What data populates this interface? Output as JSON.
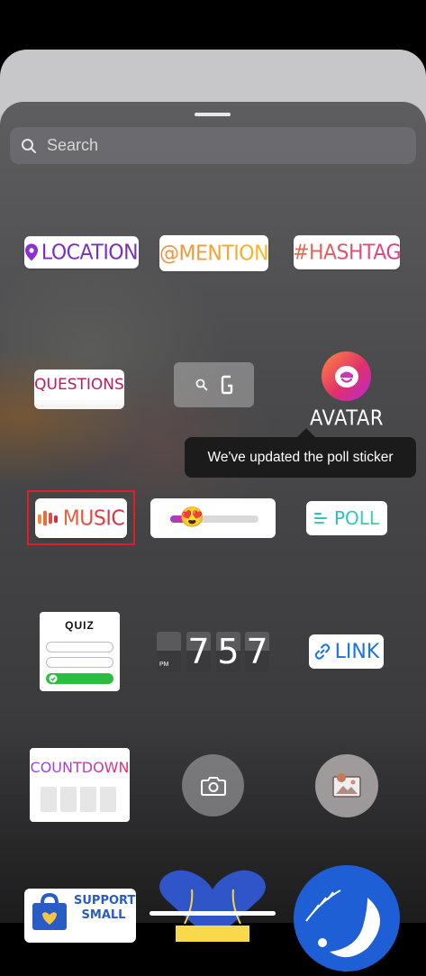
{
  "search": {
    "placeholder": "Search"
  },
  "stickers": {
    "location": "LOCATION",
    "mention": "@MENTION",
    "hashtag": "#HASHTAG",
    "questions": "QUESTIONS",
    "avatar": "AVATAR",
    "music": "MUSIC",
    "poll": "POLL",
    "quiz": "QUIZ",
    "countdown_digits": [
      "7",
      "5",
      "7"
    ],
    "countdown_pm": "PM",
    "link": "LINK",
    "countdown": "COUNTDOWN",
    "support_small": "SUPPORT SMALL",
    "slider_emoji": "😍",
    "slider_level": 0.22
  },
  "tooltip": {
    "text": "We've updated the poll sticker"
  },
  "colors": {
    "highlight": "#e01d2a",
    "link": "#1b74e4"
  },
  "icons": [
    "search-icon",
    "location-pin-icon",
    "gif-search-icon",
    "avatar-icon",
    "music-bars-icon",
    "poll-lines-icon",
    "link-chain-icon",
    "camera-icon",
    "photo-icon",
    "shopping-bag-icon"
  ]
}
